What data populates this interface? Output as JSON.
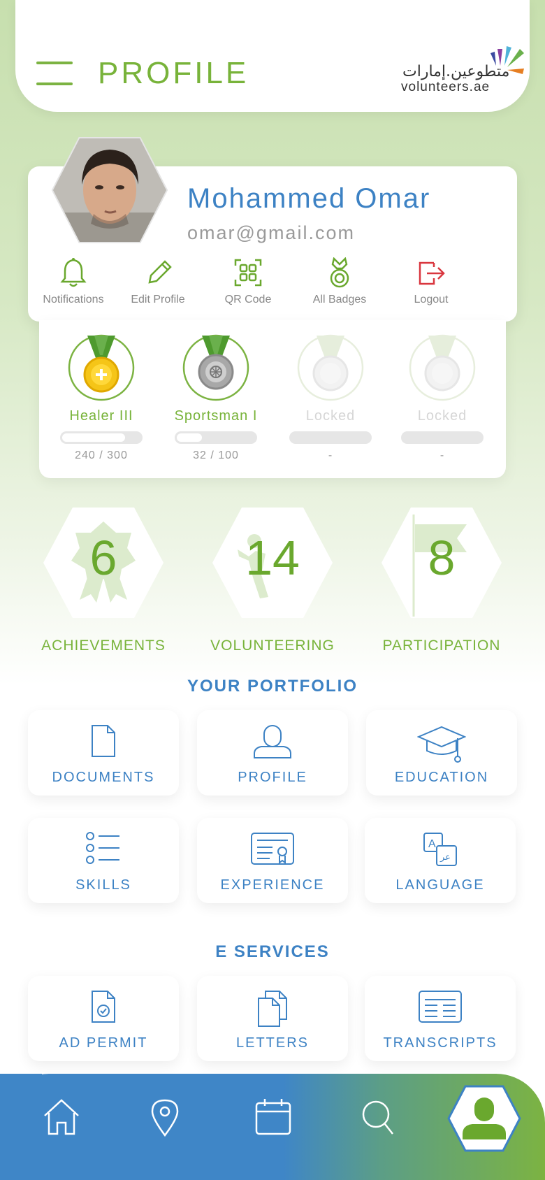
{
  "header": {
    "title": "PROFILE",
    "logo_arabic": "متطوعين.إمارات",
    "logo_english": "volunteers.ae"
  },
  "user": {
    "name": "Mohammed Omar",
    "email": "omar@gmail.com"
  },
  "quick_actions": [
    {
      "label": "Notifications",
      "icon": "bell-icon"
    },
    {
      "label": "Edit Profile",
      "icon": "pencil-icon"
    },
    {
      "label": "QR Code",
      "icon": "qr-code-icon"
    },
    {
      "label": "All Badges",
      "icon": "medal-icon"
    },
    {
      "label": "Logout",
      "icon": "logout-icon"
    }
  ],
  "badges": [
    {
      "name": "Healer III",
      "progress_text": "240 / 300",
      "progress": 0.8,
      "locked": false,
      "medal": "gold"
    },
    {
      "name": "Sportsman I",
      "progress_text": "32 / 100",
      "progress": 0.32,
      "locked": false,
      "medal": "silver"
    },
    {
      "name": "Locked",
      "progress_text": "-",
      "progress": 0,
      "locked": true
    },
    {
      "name": "Locked",
      "progress_text": "-",
      "progress": 0,
      "locked": true
    }
  ],
  "stats": [
    {
      "value": "6",
      "label": "ACHIEVEMENTS",
      "icon": "ribbon-icon"
    },
    {
      "value": "14",
      "label": "VOLUNTEERING",
      "icon": "volunteer-icon"
    },
    {
      "value": "8",
      "label": "PARTICIPATION",
      "icon": "flag-icon"
    }
  ],
  "portfolio": {
    "title": "YOUR PORTFOLIO",
    "items": [
      {
        "label": "DOCUMENTS",
        "icon": "document-icon"
      },
      {
        "label": "PROFILE",
        "icon": "user-icon"
      },
      {
        "label": "EDUCATION",
        "icon": "graduation-cap-icon"
      },
      {
        "label": "SKILLS",
        "icon": "list-icon"
      },
      {
        "label": "EXPERIENCE",
        "icon": "certificate-icon"
      },
      {
        "label": "LANGUAGE",
        "icon": "translate-icon"
      }
    ]
  },
  "eservices": {
    "title": "E SERVICES",
    "items": [
      {
        "label": "AD PERMIT",
        "icon": "permit-document-icon"
      },
      {
        "label": "LETTERS",
        "icon": "letters-icon"
      },
      {
        "label": "TRANSCRIPTS",
        "icon": "transcript-icon"
      }
    ]
  },
  "bottom_nav": [
    {
      "icon": "home-icon"
    },
    {
      "icon": "location-pin-icon"
    },
    {
      "icon": "calendar-icon"
    },
    {
      "icon": "search-icon"
    },
    {
      "icon": "profile-icon",
      "active": true
    }
  ],
  "colors": {
    "brand_blue": "#3d82c4",
    "brand_green": "#78b33a",
    "logout_red": "#d9363e",
    "gold": "#f5c518"
  }
}
